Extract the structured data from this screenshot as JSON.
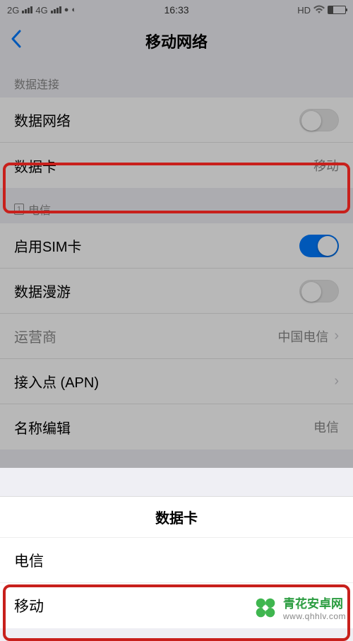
{
  "statusBar": {
    "network1": "2G",
    "network2": "4G",
    "time": "16:33",
    "hd": "HD"
  },
  "header": {
    "title": "移动网络"
  },
  "sections": {
    "dataConnection": {
      "label": "数据连接",
      "rows": {
        "dataNetwork": {
          "label": "数据网络"
        },
        "dataCard": {
          "label": "数据卡",
          "value": "移动"
        }
      }
    },
    "sim": {
      "simNumber": "1",
      "label": "电信",
      "rows": {
        "enableSim": {
          "label": "启用SIM卡"
        },
        "roaming": {
          "label": "数据漫游"
        },
        "carrier": {
          "label": "运营商",
          "value": "中国电信"
        },
        "apn": {
          "label": "接入点 (APN)"
        },
        "nameEdit": {
          "label": "名称编辑",
          "value": "电信"
        }
      }
    }
  },
  "sheet": {
    "title": "数据卡",
    "options": [
      "电信",
      "移动"
    ]
  },
  "watermark": {
    "title": "青花安卓网",
    "url": "www.qhhlv.com"
  }
}
